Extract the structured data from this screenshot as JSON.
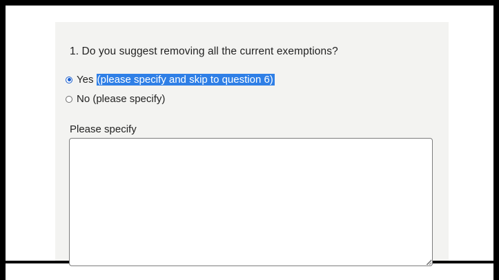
{
  "question": {
    "title": "1. Do you suggest removing all the current exemptions?"
  },
  "options": [
    {
      "label_prefix": "Yes",
      "label_highlighted": "(please specify and skip to question 6)",
      "checked": true
    },
    {
      "label": "No (please specify)",
      "checked": false
    }
  ],
  "specify": {
    "label": "Please specify",
    "value": ""
  },
  "colors": {
    "panel_background": "#f3f3f1",
    "selection_highlight": "#2f7fe6",
    "radio_selected": "#1a5fd0",
    "frame": "#000000"
  }
}
